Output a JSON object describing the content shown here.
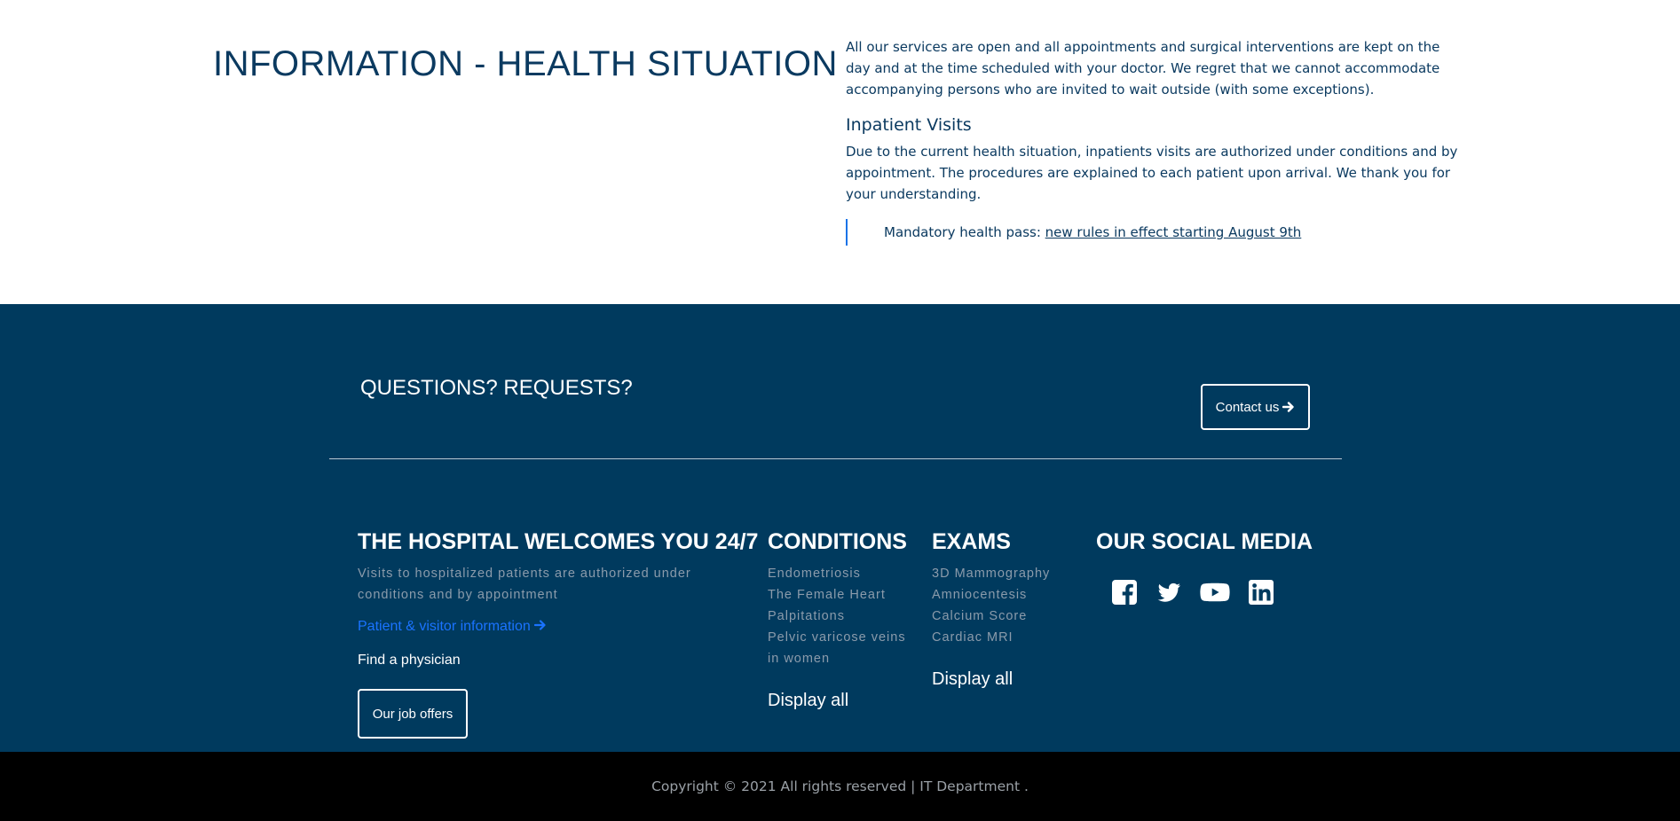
{
  "info": {
    "title": "INFORMATION - HEALTH SITUATION",
    "intro": "All our services are open and all appointments and surgical interventions are kept on the day and at the time scheduled with your doctor. We regret that we cannot accommodate accompanying persons who are invited to wait outside (with some exceptions).",
    "inpatient_heading": "Inpatient Visits",
    "inpatient_text": "Due to the current health situation, inpatients visits are authorized under conditions and by appointment. The procedures are explained to each patient upon arrival. We thank you for your understanding.",
    "quote_prefix": "Mandatory health pass: ",
    "quote_link": "new rules in effect starting August 9th"
  },
  "questions": {
    "title": "QUESTIONS? REQUESTS?",
    "contact_label": "Contact us",
    "contact_icon": "arrow-right-icon"
  },
  "welcome": {
    "heading": "THE HOSPITAL WELCOMES YOU 24/7",
    "text": "Visits to hospitalized patients are authorized under conditions and by appointment",
    "patient_link": "Patient & visitor information",
    "physician_link": "Find a physician",
    "jobs_button": "Our job offers"
  },
  "conditions": {
    "heading": "CONDITIONS",
    "items": [
      "Endometriosis",
      "The Female Heart",
      "Palpitations",
      "Pelvic varicose veins in women"
    ],
    "display_all": "Display all"
  },
  "exams": {
    "heading": "EXAMS",
    "items": [
      "3D Mammography",
      "Amniocentesis",
      "Calcium Score",
      "Cardiac MRI"
    ],
    "display_all": "Display all"
  },
  "social": {
    "heading": "OUR SOCIAL MEDIA",
    "icons": [
      "facebook-icon",
      "twitter-icon",
      "youtube-icon",
      "linkedin-icon"
    ]
  },
  "copyright": "Copyright © 2021 All rights reserved | IT Department .",
  "colors": {
    "footer_bg": "#003a5e",
    "title_text": "#0b3a60",
    "link_blue": "#1a73ff",
    "copyright_bg": "#000000"
  }
}
